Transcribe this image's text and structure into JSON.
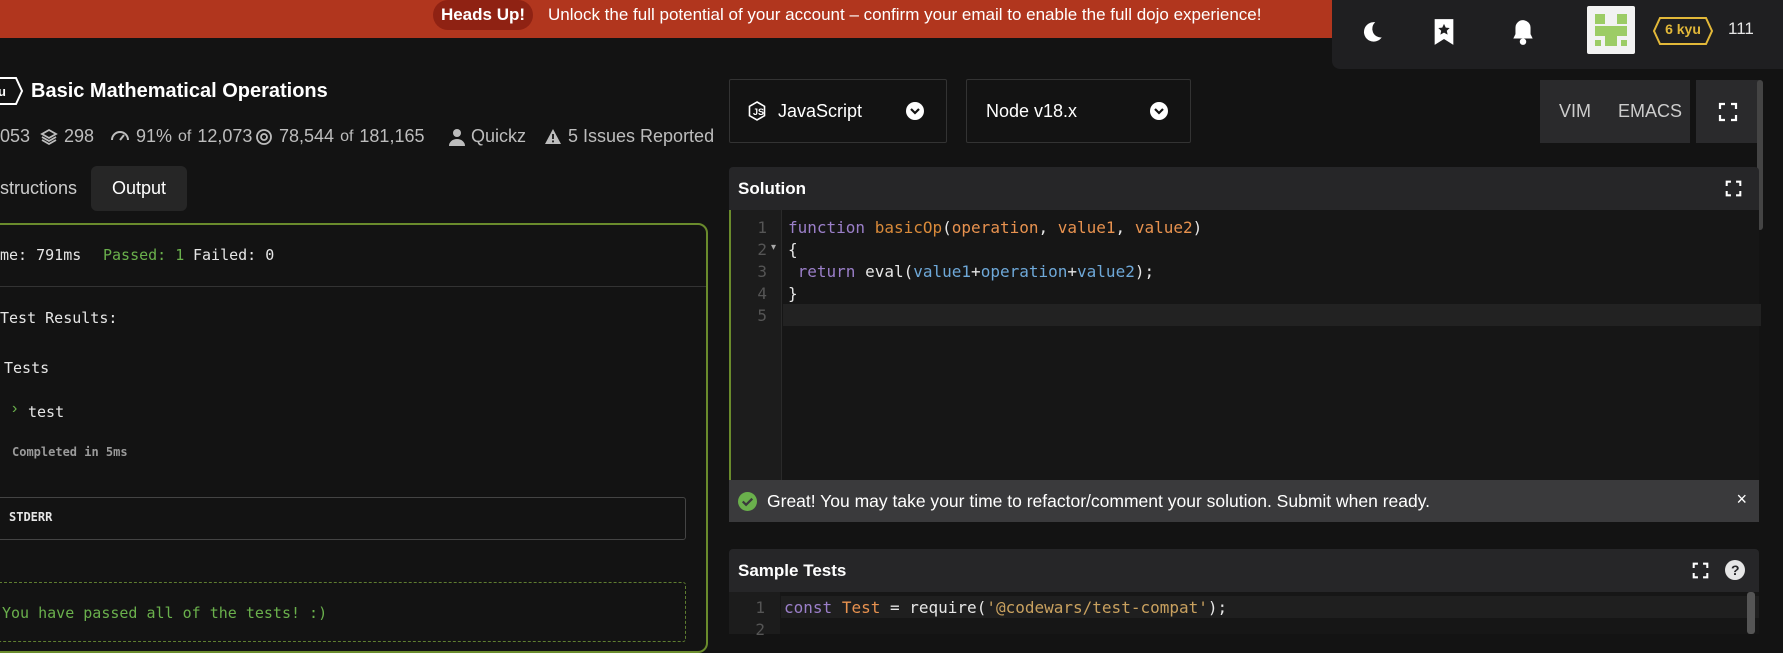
{
  "banner": {
    "pill": "Heads Up!",
    "message": "Unlock the full potential of your account – confirm your email to enable the full dojo experience!"
  },
  "topbar": {
    "kyu": "6 kyu",
    "honor": "111"
  },
  "kata": {
    "badge": "u",
    "title": "Basic Mathematical Operations",
    "stats": {
      "count_partial": "053",
      "collections": "298",
      "satisfaction": "91%",
      "of1": "of",
      "votes": "12,073",
      "completed": "78,544",
      "of2": "of",
      "attempts": "181,165",
      "author": "Quickz",
      "issues": "5 Issues Reported"
    }
  },
  "tabs": {
    "instructions": "structions",
    "output": "Output"
  },
  "output": {
    "time": "me: 791ms",
    "passed": "Passed: 1",
    "failed": "Failed: 0",
    "results_heading": "Test Results:",
    "group": "Tests",
    "test_name": "test",
    "completed": "Completed in 5ms",
    "stderr": "STDERR",
    "pass_message": "You have passed all of the tests! :)"
  },
  "lang": {
    "label": "JavaScript",
    "version": "Node v18.x"
  },
  "modes": {
    "vim": "VIM",
    "emacs": "EMACS"
  },
  "solution": {
    "title": "Solution",
    "lines": {
      "l1_kw": "function",
      "l1_fn": "basicOp",
      "l1_p1": "operation",
      "l1_p2": "value1",
      "l1_p3": "value2",
      "l2": "{",
      "l3_kw": "return",
      "l3_fn": "eval",
      "l3_a": "value1",
      "l3_b": "operation",
      "l3_c": "value2",
      "l4": "}"
    },
    "line_numbers": [
      "1",
      "2",
      "3",
      "4",
      "5"
    ]
  },
  "alert": {
    "message": "Great! You may take your time to refactor/comment your solution. Submit when ready.",
    "close": "×"
  },
  "sample_tests": {
    "title": "Sample Tests",
    "line1_kw": "const",
    "line1_var": "Test",
    "line1_fn": "require",
    "line1_str": "'@codewars/test-compat'",
    "line_numbers": [
      "1",
      "2"
    ]
  },
  "colors": {
    "banner": "#b1361e",
    "keyword": "#9b7fc9",
    "function": "#d98a3a",
    "param": "#e8924f",
    "variable": "#6ea8d8",
    "pass": "#6ab04c",
    "kyu": "#e2b839"
  }
}
